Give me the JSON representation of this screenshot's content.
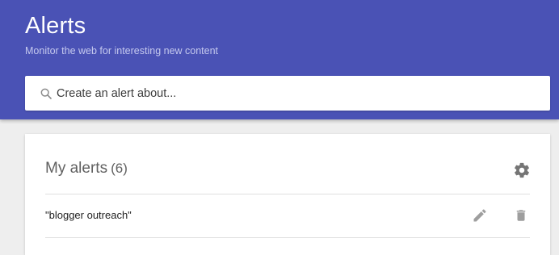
{
  "header": {
    "title": "Alerts",
    "subtitle": "Monitor the web for interesting new content",
    "background_color": "#4a52b5"
  },
  "search": {
    "placeholder": "Create an alert about...",
    "value": "",
    "icon": "search-icon"
  },
  "alerts_card": {
    "title": "My alerts",
    "count": "(6)",
    "settings_icon": "gear-icon",
    "items": [
      {
        "query": "\"blogger outreach\"",
        "edit_icon": "pencil-icon",
        "delete_icon": "trash-icon"
      }
    ]
  }
}
